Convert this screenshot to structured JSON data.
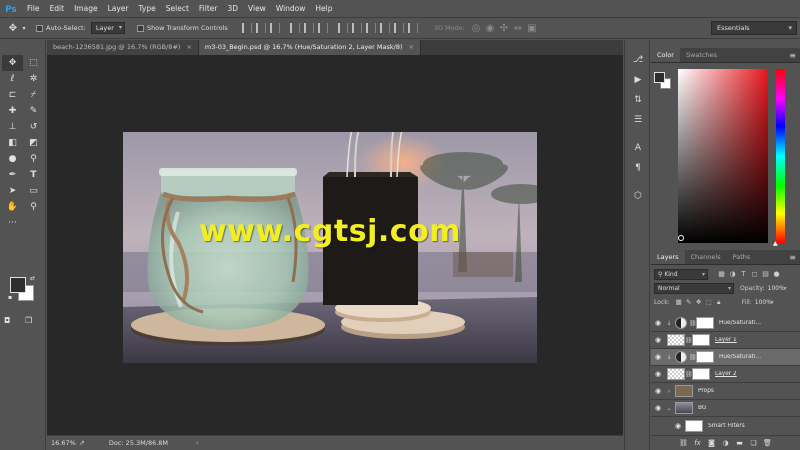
{
  "app": {
    "logo": "Ps"
  },
  "menu": [
    "File",
    "Edit",
    "Image",
    "Layer",
    "Type",
    "Select",
    "Filter",
    "3D",
    "View",
    "Window",
    "Help"
  ],
  "options": {
    "auto_select_label": "Auto-Select:",
    "auto_select_value": "Layer",
    "show_transform_label": "Show Transform Controls",
    "mode_3d": "3D Mode:",
    "workspace": "Essentials"
  },
  "tabs": [
    {
      "label": "beach-1236581.jpg @ 16.7% (RGB/8#)",
      "close": "×",
      "active": false
    },
    {
      "label": "m3-03_Begin.psd @ 16.7% (Hue/Saturation 2, Layer Mask/8)",
      "close": "×",
      "active": true
    }
  ],
  "canvas": {
    "watermark": "www.cgtsj.com"
  },
  "status": {
    "zoom": "16.67%",
    "doc": "Doc: 25.3M/86.8M",
    "arrow": "›"
  },
  "color_panel": {
    "tabs": [
      "Color",
      "Swatches"
    ]
  },
  "layers_panel": {
    "tabs": [
      "Layers",
      "Channels",
      "Paths"
    ],
    "kind": "Kind",
    "blend_mode": "Normal",
    "opacity_label": "Opacity:",
    "opacity_value": "100%",
    "lock_label": "Lock:",
    "fill_label": "Fill:",
    "fill_value": "100%",
    "layers": [
      {
        "name": "Hue/Saturati...",
        "type": "adjustment"
      },
      {
        "name": "Layer 1",
        "type": "pixel"
      },
      {
        "name": "Hue/Saturati...",
        "type": "adjustment"
      },
      {
        "name": "Layer 2",
        "type": "pixel"
      },
      {
        "name": "Props",
        "type": "group"
      },
      {
        "name": "BG",
        "type": "smart"
      },
      {
        "name": "Smart Filters",
        "type": "filter"
      }
    ]
  },
  "colors": {
    "watermark": "#f3ee21",
    "ps_blue": "#31a8ff",
    "panel_bg": "#535353",
    "canvas_bg": "#282828"
  }
}
